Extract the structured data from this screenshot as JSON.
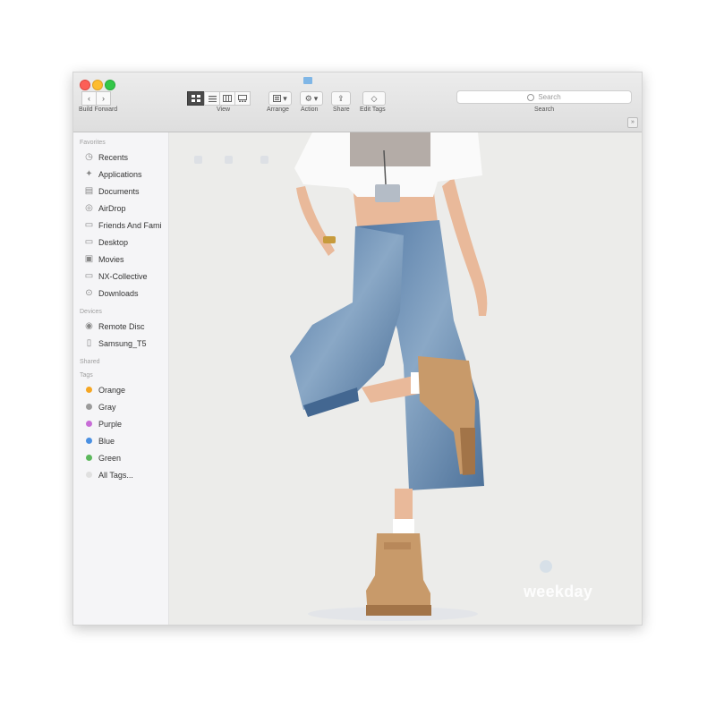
{
  "window": {
    "path_label": "Build Forward"
  },
  "toolbar": {
    "labels": {
      "view": "View",
      "arrange": "Arrange",
      "action": "Action",
      "share": "Share",
      "edit_tags": "Edit Tags",
      "search": "Search"
    },
    "search_placeholder": "Search",
    "glyphs": {
      "back": "‹",
      "forward": "›",
      "dropdown": "▾",
      "share": "⇪",
      "tag": "◇",
      "action": "⚙",
      "sidebar_toggle": "»"
    }
  },
  "sidebar": {
    "sections": {
      "favorites": "Favorites",
      "devices": "Devices",
      "shared": "Shared",
      "tags": "Tags"
    },
    "favorites": [
      {
        "label": "Recents",
        "icon": "clock-icon",
        "glyph": "◷"
      },
      {
        "label": "Applications",
        "icon": "applications-icon",
        "glyph": "✦"
      },
      {
        "label": "Documents",
        "icon": "documents-icon",
        "glyph": "▤"
      },
      {
        "label": "AirDrop",
        "icon": "airdrop-icon",
        "glyph": "◎"
      },
      {
        "label": "Friends And Fami",
        "icon": "folder-icon",
        "glyph": "▭"
      },
      {
        "label": "Desktop",
        "icon": "desktop-icon",
        "glyph": "▭"
      },
      {
        "label": "Movies",
        "icon": "movies-icon",
        "glyph": "▣"
      },
      {
        "label": "NX-Collective",
        "icon": "folder-icon",
        "glyph": "▭"
      },
      {
        "label": "Downloads",
        "icon": "downloads-icon",
        "glyph": "⊙"
      }
    ],
    "devices": [
      {
        "label": "Remote Disc",
        "icon": "disc-icon",
        "glyph": "◉"
      },
      {
        "label": "Samsung_T5",
        "icon": "drive-icon",
        "glyph": "▯"
      }
    ],
    "tags": [
      {
        "label": "Orange",
        "color": "#f5a623"
      },
      {
        "label": "Gray",
        "color": "#9b9b9b"
      },
      {
        "label": "Purple",
        "color": "#c86dd7"
      },
      {
        "label": "Blue",
        "color": "#4a90e2"
      },
      {
        "label": "Green",
        "color": "#5cb85c"
      },
      {
        "label": "All Tags...",
        "color": "#e0e0e0"
      }
    ]
  },
  "content": {
    "watermark": "weekday",
    "photo": {
      "background": "#ececea",
      "shirt": "#fafafa",
      "denim": "#5f84ad",
      "boot": "#c89a6a",
      "skin": "#e9b99a",
      "hair": "#2a211c"
    }
  }
}
